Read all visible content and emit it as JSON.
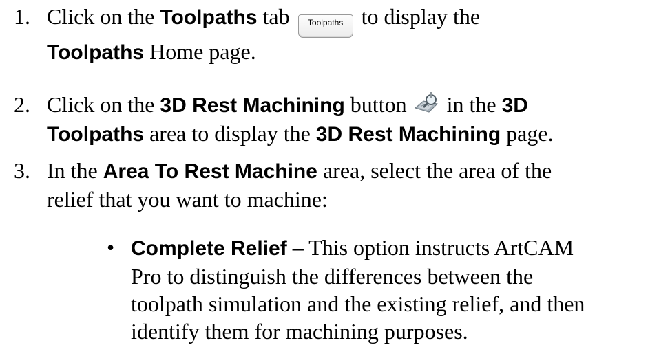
{
  "steps": [
    {
      "num": "1.",
      "t1": "Click on the ",
      "b1": "Toolpaths",
      "t2": " tab ",
      "tab_label": "Toolpaths",
      "t3": " to display the",
      "b2": "Toolpaths",
      "t4": " Home page."
    },
    {
      "num": "2.",
      "t1": "Click on the ",
      "b1": "3D Rest Machining",
      "t2": " button ",
      "icon": "3d-rest-machining-icon",
      "t3": " in the ",
      "b2": "3D",
      "b3": "Toolpaths",
      "t4": " area to display the ",
      "b4": "3D Rest Machining",
      "t5": " page."
    },
    {
      "num": "3.",
      "t1": "In the ",
      "b1": "Area To Rest Machine",
      "t2": " area, select the area of the",
      "t3": "relief that you want to machine:"
    }
  ],
  "bullet": {
    "symbol": "•",
    "b1": "Complete Relief",
    "t1": " – This option instructs ArtCAM",
    "t2": "Pro to distinguish the differences between the",
    "t3": "toolpath simulation and the existing relief, and then",
    "t4": "identify them for machining purposes."
  }
}
